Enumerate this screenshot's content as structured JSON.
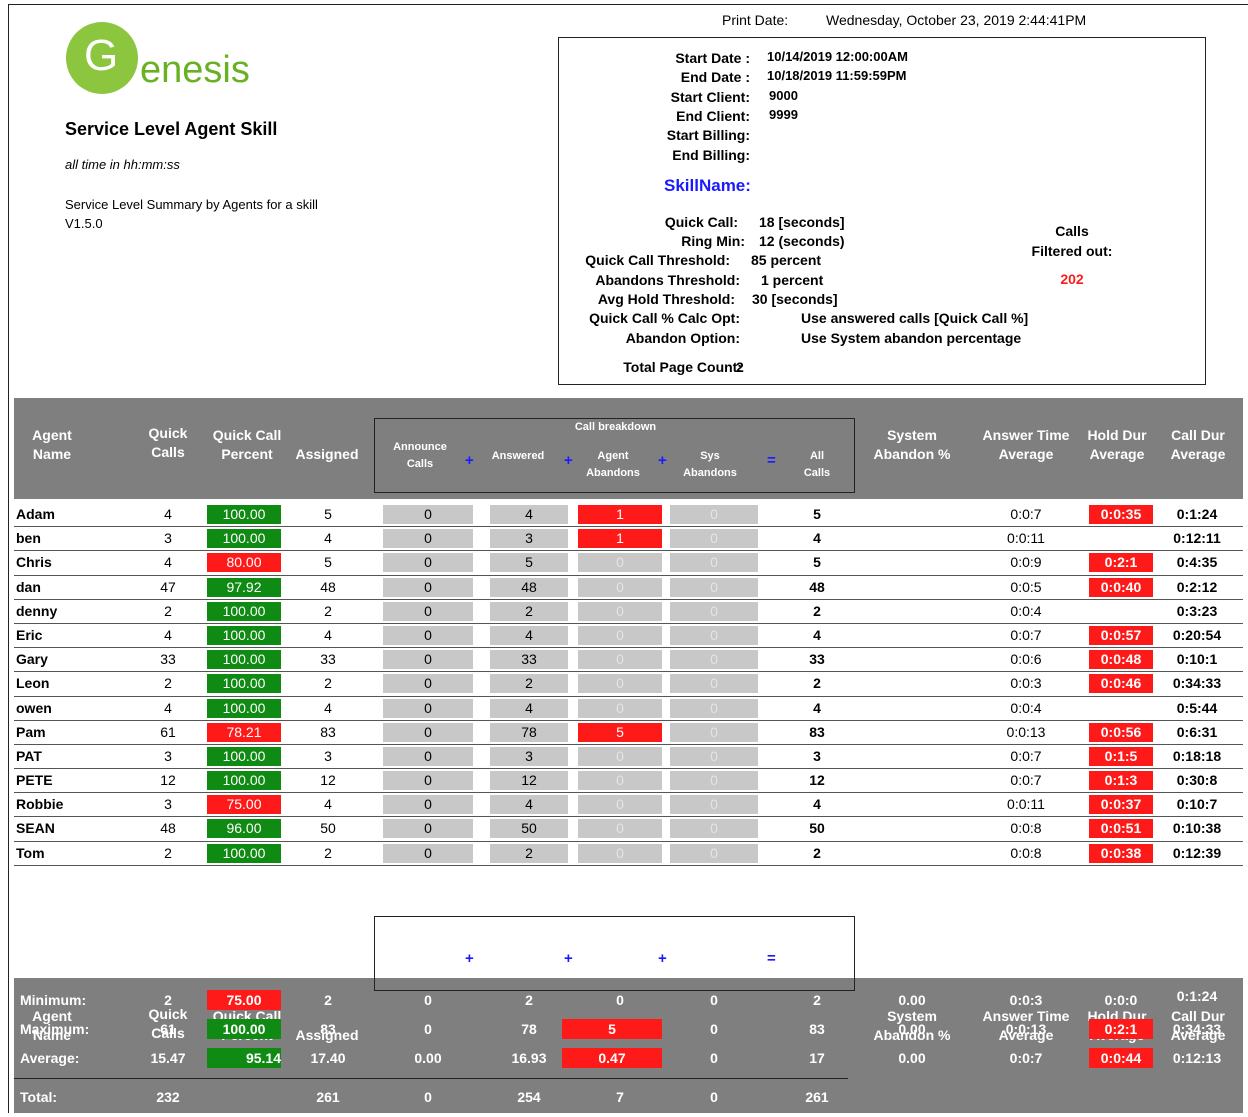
{
  "print": {
    "label": "Print Date:",
    "value": "Wednesday, October 23, 2019   2:44:41PM"
  },
  "logo": {
    "letter": "G",
    "rest": "enesis"
  },
  "report": {
    "title": "Service Level Agent Skill",
    "subtitle": "all time in hh:mm:ss",
    "description": "Service Level Summary by Agents for a skill",
    "version": "V1.5.0"
  },
  "params": {
    "start_date_label": "Start Date :",
    "start_date": "10/14/2019  12:00:00AM",
    "end_date_label": "End Date :",
    "end_date": "10/18/2019  11:59:59PM",
    "start_client_label": "Start Client:",
    "start_client": "9000",
    "end_client_label": "End Client:",
    "end_client": "9999",
    "start_billing_label": "Start Billing:",
    "end_billing_label": "End Billing:",
    "skill_name_label": "SkillName:",
    "quick_call_label": "Quick Call:",
    "quick_call": "18 [seconds]",
    "ring_min_label": "Ring Min:",
    "ring_min": "12 (seconds)",
    "qc_threshold_label": "Quick Call Threshold:",
    "qc_threshold": "85 percent",
    "ab_threshold_label": "Abandons Threshold:",
    "ab_threshold": "1 percent",
    "hold_threshold_label": "Avg Hold Threshold:",
    "hold_threshold": "30 [seconds]",
    "qc_calc_label": "Quick Call % Calc Opt:",
    "qc_calc": "Use answered calls [Quick Call %]",
    "abandon_opt_label": "Abandon Option:",
    "abandon_opt": "Use System abandon percentage",
    "page_count_label": "Total Page Count:",
    "page_count": "2",
    "filtered_label_1": "Calls",
    "filtered_label_2": "Filtered out:",
    "filtered_value": "202"
  },
  "columns": {
    "agent_1": "Agent",
    "agent_2": "Name",
    "quick_1": "Quick",
    "quick_2": "Calls",
    "qcp_1": "Quick Call",
    "qcp_2": "Percent",
    "assigned": "Assigned",
    "breakdown": "Call breakdown",
    "announce_1": "Announce",
    "announce_2": "Calls",
    "answered": "Answered",
    "agent_ab_1": "Agent",
    "agent_ab_2": "Abandons",
    "sys_ab_1": "Sys",
    "sys_ab_2": "Abandons",
    "all_1": "All",
    "all_2": "Calls",
    "plus": "+",
    "equals": "=",
    "sys_ab_pct_1": "System",
    "sys_ab_pct_2": "Abandon %",
    "ans_avg_1": "Answer Time",
    "ans_avg_2": "Average",
    "hold_avg_1": "Hold Dur",
    "hold_avg_2": "Average",
    "call_avg_1": "Call Dur",
    "call_avg_2": "Average"
  },
  "agents": [
    {
      "name": "Adam",
      "quick": "4",
      "pct": "100.00",
      "pct_color": "green",
      "assigned": "5",
      "announce": "0",
      "answered": "4",
      "agent_ab": "1",
      "agent_ab_red": true,
      "sys_ab": "0",
      "all": "5",
      "ans_avg": "0:0:7",
      "hold": "0:0:35",
      "hold_red": true,
      "call": "0:1:24"
    },
    {
      "name": "ben",
      "quick": "3",
      "pct": "100.00",
      "pct_color": "green",
      "assigned": "4",
      "announce": "0",
      "answered": "3",
      "agent_ab": "1",
      "agent_ab_red": true,
      "sys_ab": "0",
      "all": "4",
      "ans_avg": "0:0:11",
      "hold": "",
      "hold_red": false,
      "call": "0:12:11"
    },
    {
      "name": "Chris",
      "quick": "4",
      "pct": "80.00",
      "pct_color": "red",
      "assigned": "5",
      "announce": "0",
      "answered": "5",
      "agent_ab": "0",
      "agent_ab_red": false,
      "sys_ab": "0",
      "all": "5",
      "ans_avg": "0:0:9",
      "hold": "0:2:1",
      "hold_red": true,
      "call": "0:4:35"
    },
    {
      "name": "dan",
      "quick": "47",
      "pct": "97.92",
      "pct_color": "green",
      "assigned": "48",
      "announce": "0",
      "answered": "48",
      "agent_ab": "0",
      "agent_ab_red": false,
      "sys_ab": "0",
      "all": "48",
      "ans_avg": "0:0:5",
      "hold": "0:0:40",
      "hold_red": true,
      "call": "0:2:12"
    },
    {
      "name": "denny",
      "quick": "2",
      "pct": "100.00",
      "pct_color": "green",
      "assigned": "2",
      "announce": "0",
      "answered": "2",
      "agent_ab": "0",
      "agent_ab_red": false,
      "sys_ab": "0",
      "all": "2",
      "ans_avg": "0:0:4",
      "hold": "",
      "hold_red": false,
      "call": "0:3:23"
    },
    {
      "name": "Eric",
      "quick": "4",
      "pct": "100.00",
      "pct_color": "green",
      "assigned": "4",
      "announce": "0",
      "answered": "4",
      "agent_ab": "0",
      "agent_ab_red": false,
      "sys_ab": "0",
      "all": "4",
      "ans_avg": "0:0:7",
      "hold": "0:0:57",
      "hold_red": true,
      "call": "0:20:54"
    },
    {
      "name": "Gary",
      "quick": "33",
      "pct": "100.00",
      "pct_color": "green",
      "assigned": "33",
      "announce": "0",
      "answered": "33",
      "agent_ab": "0",
      "agent_ab_red": false,
      "sys_ab": "0",
      "all": "33",
      "ans_avg": "0:0:6",
      "hold": "0:0:48",
      "hold_red": true,
      "call": "0:10:1"
    },
    {
      "name": "Leon",
      "quick": "2",
      "pct": "100.00",
      "pct_color": "green",
      "assigned": "2",
      "announce": "0",
      "answered": "2",
      "agent_ab": "0",
      "agent_ab_red": false,
      "sys_ab": "0",
      "all": "2",
      "ans_avg": "0:0:3",
      "hold": "0:0:46",
      "hold_red": true,
      "call": "0:34:33"
    },
    {
      "name": "owen",
      "quick": "4",
      "pct": "100.00",
      "pct_color": "green",
      "assigned": "4",
      "announce": "0",
      "answered": "4",
      "agent_ab": "0",
      "agent_ab_red": false,
      "sys_ab": "0",
      "all": "4",
      "ans_avg": "0:0:4",
      "hold": "",
      "hold_red": false,
      "call": "0:5:44"
    },
    {
      "name": "Pam",
      "quick": "61",
      "pct": "78.21",
      "pct_color": "red",
      "assigned": "83",
      "announce": "0",
      "answered": "78",
      "agent_ab": "5",
      "agent_ab_red": true,
      "sys_ab": "0",
      "all": "83",
      "ans_avg": "0:0:13",
      "hold": "0:0:56",
      "hold_red": true,
      "call": "0:6:31"
    },
    {
      "name": "PAT",
      "quick": "3",
      "pct": "100.00",
      "pct_color": "green",
      "assigned": "3",
      "announce": "0",
      "answered": "3",
      "agent_ab": "0",
      "agent_ab_red": false,
      "sys_ab": "0",
      "all": "3",
      "ans_avg": "0:0:7",
      "hold": "0:1:5",
      "hold_red": true,
      "call": "0:18:18"
    },
    {
      "name": "PETE",
      "quick": "12",
      "pct": "100.00",
      "pct_color": "green",
      "assigned": "12",
      "announce": "0",
      "answered": "12",
      "agent_ab": "0",
      "agent_ab_red": false,
      "sys_ab": "0",
      "all": "12",
      "ans_avg": "0:0:7",
      "hold": "0:1:3",
      "hold_red": true,
      "call": "0:30:8"
    },
    {
      "name": "Robbie",
      "quick": "3",
      "pct": "75.00",
      "pct_color": "red",
      "assigned": "4",
      "announce": "0",
      "answered": "4",
      "agent_ab": "0",
      "agent_ab_red": false,
      "sys_ab": "0",
      "all": "4",
      "ans_avg": "0:0:11",
      "hold": "0:0:37",
      "hold_red": true,
      "call": "0:10:7"
    },
    {
      "name": "SEAN",
      "quick": "48",
      "pct": "96.00",
      "pct_color": "green",
      "assigned": "50",
      "announce": "0",
      "answered": "50",
      "agent_ab": "0",
      "agent_ab_red": false,
      "sys_ab": "0",
      "all": "50",
      "ans_avg": "0:0:8",
      "hold": "0:0:51",
      "hold_red": true,
      "call": "0:10:38"
    },
    {
      "name": "Tom",
      "quick": "2",
      "pct": "100.00",
      "pct_color": "green",
      "assigned": "2",
      "announce": "0",
      "answered": "2",
      "agent_ab": "0",
      "agent_ab_red": false,
      "sys_ab": "0",
      "all": "2",
      "ans_avg": "0:0:8",
      "hold": "0:0:38",
      "hold_red": true,
      "call": "0:12:39"
    }
  ],
  "summary": {
    "min": {
      "label": "Minimum:",
      "quick": "2",
      "pct": "75.00",
      "assigned": "2",
      "announce": "0",
      "answered": "2",
      "agent_ab": "0",
      "sys_ab": "0",
      "all": "2",
      "sys_pct": "0.00",
      "ans_avg": "0:0:3",
      "hold": "0:0:0",
      "call": "0:1:24"
    },
    "max": {
      "label": "Maximum:",
      "quick": "61",
      "pct": "100.00",
      "assigned": "83",
      "announce": "0",
      "answered": "78",
      "agent_ab": "5",
      "sys_ab": "0",
      "all": "83",
      "sys_pct": "0.00",
      "ans_avg": "0:0:13",
      "hold": "0:2:1",
      "call": "0:34:33"
    },
    "avg": {
      "label": "Average:",
      "quick": "15.47",
      "pct": "95.14",
      "assigned": "17.40",
      "announce": "0.00",
      "answered": "16.93",
      "agent_ab": "0.47",
      "sys_ab": "0",
      "all": "17",
      "sys_pct": "0.00",
      "ans_avg": "0:0:7",
      "hold": "0:0:44",
      "call": "0:12:13"
    },
    "total": {
      "label": "Total:",
      "quick": "232",
      "assigned": "261",
      "announce": "0",
      "answered": "254",
      "agent_ab": "7",
      "sys_ab": "0",
      "all": "261"
    }
  },
  "colors": {
    "green": "#0f8a12",
    "red": "#ff1a1a",
    "gray": "#c8c8c8",
    "header": "#7f7f7f",
    "skill": "#1a1aff",
    "logo": "#8cc63f"
  }
}
